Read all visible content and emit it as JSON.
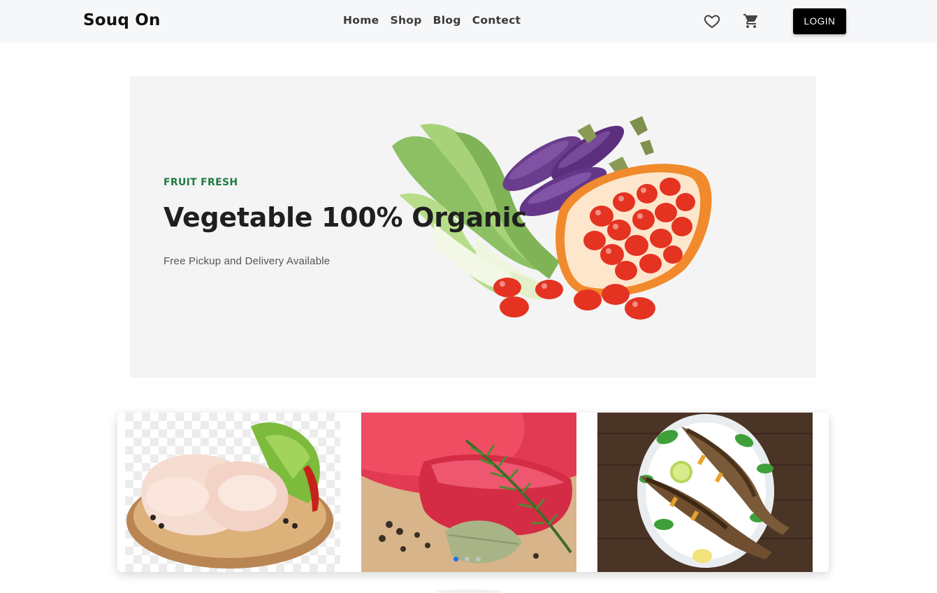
{
  "header": {
    "brand": "Souq On",
    "nav": [
      "Home",
      "Shop",
      "Blog",
      "Contect"
    ],
    "icons": [
      "favorite-heart-icon",
      "shopping-cart-icon"
    ],
    "login_label": "LOGIN"
  },
  "hero": {
    "eyebrow": "FRUIT FRESH",
    "title": "Vegetable 100% Organic",
    "subtitle": "Free Pickup and Delivery Available"
  },
  "carousel": {
    "slides": [
      "raw-chicken-image",
      "raw-beef-image",
      "grilled-fish-image"
    ],
    "active_dot": 0,
    "dot_count": 3
  },
  "colors": {
    "accent_green": "#1f7a43",
    "active_dot": "#1a73e8",
    "login_bg": "#000000",
    "header_bg": "#f6f7f9",
    "hero_bg": "#f4f4f5"
  }
}
